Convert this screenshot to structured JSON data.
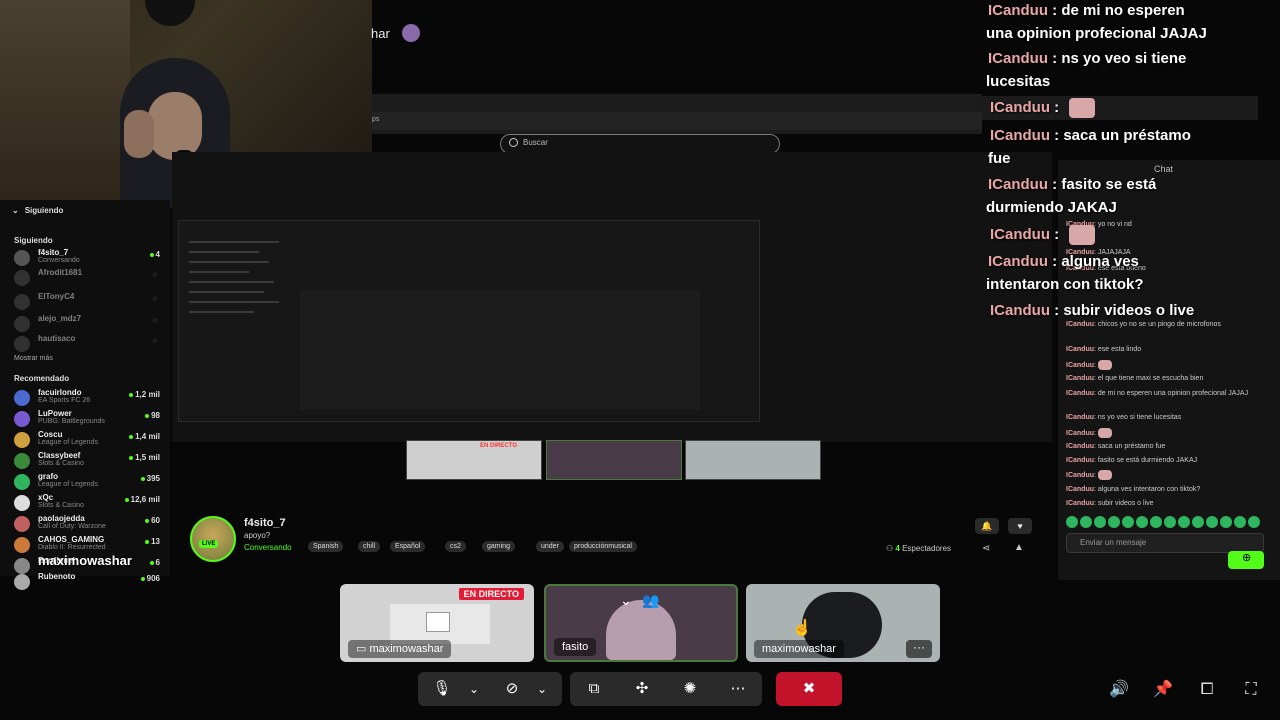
{
  "stream_overlay": {
    "top_streamer_name": "har",
    "bottom_streamer_name": "maximowashar"
  },
  "browser": {
    "tab_text": "ps",
    "search_placeholder": "Buscar"
  },
  "sidebar": {
    "following_toggle": "Siguiendo",
    "following_heading": "Siguiendo",
    "following": [
      {
        "name": "f4sito_7",
        "category": "Conversando",
        "count": "4",
        "live": true
      },
      {
        "name": "Afrodit1681",
        "category": "",
        "count": "",
        "live": false
      },
      {
        "name": "ElTonyC4",
        "category": "",
        "count": "",
        "live": false
      },
      {
        "name": "alejo_mdz7",
        "category": "",
        "count": "",
        "live": false
      },
      {
        "name": "hautisaco",
        "category": "",
        "count": "",
        "live": false
      }
    ],
    "show_more": "Mostrar más",
    "recommended_heading": "Recomendado",
    "recommended": [
      {
        "name": "facuirlondo",
        "category": "EA Sports FC 26",
        "count": "1,2 mil"
      },
      {
        "name": "LuPower",
        "category": "PUBG: Battlegrounds",
        "count": "98"
      },
      {
        "name": "Coscu",
        "category": "League of Legends",
        "count": "1,4 mil"
      },
      {
        "name": "Classybeef",
        "category": "Slots & Casino",
        "count": "1,5 mil"
      },
      {
        "name": "grafo",
        "category": "League of Legends",
        "count": "395"
      },
      {
        "name": "xQc",
        "category": "Slots & Casino",
        "count": "12,6 mil"
      },
      {
        "name": "paolaojedda",
        "category": "Call of Duty: Warzone",
        "count": "60"
      },
      {
        "name": "CAHOS_GAMING",
        "category": "Diablo II: Resurrected",
        "count": "13"
      },
      {
        "name": "Bardiguel",
        "category": "",
        "count": "6"
      },
      {
        "name": "Rubenoto",
        "category": "",
        "count": "906"
      }
    ]
  },
  "stream_info": {
    "live_badge": "LIVE",
    "name": "f4sito_7",
    "title": "apoyo?",
    "category": "Conversando",
    "tags": [
      "Spanish",
      "chill",
      "Español",
      "cs2",
      "gaming",
      "under",
      "producciónmusical"
    ],
    "viewers_count": "4",
    "viewers_label": "Espectadores"
  },
  "nested": {
    "live_label": "EN DIRECTO"
  },
  "embedded_chat": {
    "title": "Chat",
    "messages": [
      {
        "user": "ICanduu",
        "text": "yo no vi nd"
      },
      {
        "user": "ICanduu",
        "text": "JAJAJAJA"
      },
      {
        "user": "ICanduu",
        "text": "ese esta bueno"
      },
      {
        "user": "ICanduu",
        "text": "chicos yo no se un pingo de microfonos"
      },
      {
        "user": "ICanduu",
        "text": "ese esta lindo"
      },
      {
        "user": "ICanduu",
        "text": ""
      },
      {
        "user": "ICanduu",
        "text": "el que tiene maxi se escucha bien"
      },
      {
        "user": "ICanduu",
        "text": "de mi no esperen una opinion profecional JAJAJ"
      },
      {
        "user": "ICanduu",
        "text": "ns yo veo si tiene lucesitas"
      },
      {
        "user": "ICanduu",
        "text": ""
      },
      {
        "user": "ICanduu",
        "text": "saca un préstamo fue"
      },
      {
        "user": "ICanduu",
        "text": "fasito se está durmiendo JAKAJ"
      },
      {
        "user": "ICanduu",
        "text": ""
      },
      {
        "user": "ICanduu",
        "text": "alguna ves intentaron con tiktok?"
      },
      {
        "user": "ICanduu",
        "text": "subir videos o live"
      }
    ],
    "input_placeholder": "Enviar un mensaje"
  },
  "overlay_chat": [
    {
      "user": "ICanduu",
      "sep": " : ",
      "text": "de mi no esperen",
      "cont": "una opinion profecional JAJAJ"
    },
    {
      "user": "ICanduu",
      "sep": " : ",
      "text": "ns yo veo si tiene",
      "cont": "lucesitas"
    },
    {
      "user": "ICanduu",
      "sep": " : ",
      "text": "",
      "cont": ""
    },
    {
      "user": "ICanduu",
      "sep": " : ",
      "text": "saca un préstamo",
      "cont": "fue"
    },
    {
      "user": "ICanduu",
      "sep": " : ",
      "text": "fasito se está",
      "cont": "durmiendo JAKAJ"
    },
    {
      "user": "ICanduu",
      "sep": " : ",
      "text": "",
      "cont": ""
    },
    {
      "user": "ICanduu",
      "sep": " : ",
      "text": "alguna ves",
      "cont": "intentaron con tiktok?"
    },
    {
      "user": "ICanduu",
      "sep": " : ",
      "text": "subir videos o live",
      "cont": ""
    }
  ],
  "participants": [
    {
      "name": "maximowashar",
      "badge": "EN DIRECTO",
      "kind": "screen"
    },
    {
      "name": "fasito",
      "kind": "camera"
    },
    {
      "name": "maximowashar",
      "kind": "camera",
      "menu": "···"
    }
  ],
  "controls": {
    "icons": [
      "mic-icon",
      "chevron-down-icon",
      "camera-off-icon",
      "chevron-down-icon",
      "share-screen-icon",
      "activities-icon",
      "reactions-icon",
      "more-icon",
      "leave-call-icon"
    ],
    "right_icons": [
      "volume-icon",
      "pin-icon",
      "cast-icon",
      "fullscreen-icon"
    ]
  },
  "colors": {
    "kick_green": "#53fc18",
    "leave_red": "#c3132b",
    "live_red": "#e31b36",
    "chat_user": "#e9a6a6"
  }
}
